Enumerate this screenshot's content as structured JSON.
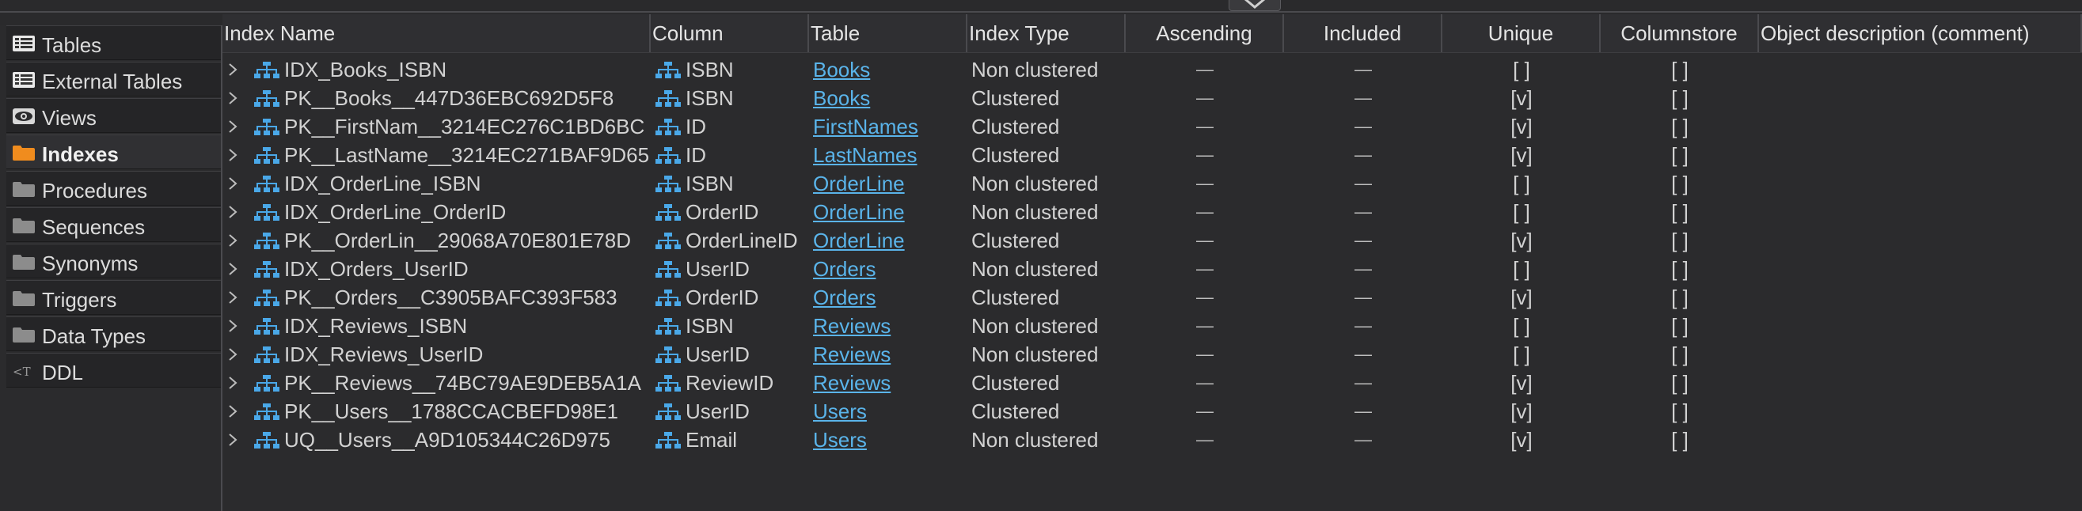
{
  "sidebar": {
    "items": [
      {
        "label": "Tables",
        "icon": "table-list-icon"
      },
      {
        "label": "External Tables",
        "icon": "table-list-icon"
      },
      {
        "label": "Views",
        "icon": "eye-icon"
      },
      {
        "label": "Indexes",
        "icon": "folder-icon",
        "active": true
      },
      {
        "label": "Procedures",
        "icon": "folder-icon"
      },
      {
        "label": "Sequences",
        "icon": "folder-icon"
      },
      {
        "label": "Synonyms",
        "icon": "folder-icon"
      },
      {
        "label": "Triggers",
        "icon": "folder-icon"
      },
      {
        "label": "Data Types",
        "icon": "folder-icon"
      },
      {
        "label": "DDL",
        "icon": "ddl-icon"
      }
    ]
  },
  "colors": {
    "background": "#2a2a2c",
    "link": "#5ab4ea",
    "active_folder": "#f08c1e",
    "folder": "#8c8c8c",
    "index_icon": "#4aa8e8"
  },
  "grid": {
    "columns": [
      "Index Name",
      "Column",
      "Table",
      "Index Type",
      "Ascending",
      "Included",
      "Unique",
      "Columnstore",
      "Object description (comment)"
    ],
    "rows": [
      {
        "name": "IDX_Books_ISBN",
        "column": "ISBN",
        "table": "Books",
        "type": "Non clustered",
        "ascending": "—",
        "included": "—",
        "unique": "[ ]",
        "columnstore": "[ ]"
      },
      {
        "name": "PK__Books__447D36EBC692D5F8",
        "column": "ISBN",
        "table": "Books",
        "type": "Clustered",
        "ascending": "—",
        "included": "—",
        "unique": "[v]",
        "columnstore": "[ ]"
      },
      {
        "name": "PK__FirstNam__3214EC276C1BD6BC",
        "column": "ID",
        "table": "FirstNames",
        "type": "Clustered",
        "ascending": "—",
        "included": "—",
        "unique": "[v]",
        "columnstore": "[ ]"
      },
      {
        "name": "PK__LastName__3214EC271BAF9D65",
        "column": "ID",
        "table": "LastNames",
        "type": "Clustered",
        "ascending": "—",
        "included": "—",
        "unique": "[v]",
        "columnstore": "[ ]"
      },
      {
        "name": "IDX_OrderLine_ISBN",
        "column": "ISBN",
        "table": "OrderLine",
        "type": "Non clustered",
        "ascending": "—",
        "included": "—",
        "unique": "[ ]",
        "columnstore": "[ ]"
      },
      {
        "name": "IDX_OrderLine_OrderID",
        "column": "OrderID",
        "table": "OrderLine",
        "type": "Non clustered",
        "ascending": "—",
        "included": "—",
        "unique": "[ ]",
        "columnstore": "[ ]"
      },
      {
        "name": "PK__OrderLin__29068A70E801E78D",
        "column": "OrderLineID",
        "table": "OrderLine",
        "type": "Clustered",
        "ascending": "—",
        "included": "—",
        "unique": "[v]",
        "columnstore": "[ ]"
      },
      {
        "name": "IDX_Orders_UserID",
        "column": "UserID",
        "table": "Orders",
        "type": "Non clustered",
        "ascending": "—",
        "included": "—",
        "unique": "[ ]",
        "columnstore": "[ ]"
      },
      {
        "name": "PK__Orders__C3905BAFC393F583",
        "column": "OrderID",
        "table": "Orders",
        "type": "Clustered",
        "ascending": "—",
        "included": "—",
        "unique": "[v]",
        "columnstore": "[ ]"
      },
      {
        "name": "IDX_Reviews_ISBN",
        "column": "ISBN",
        "table": "Reviews",
        "type": "Non clustered",
        "ascending": "—",
        "included": "—",
        "unique": "[ ]",
        "columnstore": "[ ]"
      },
      {
        "name": "IDX_Reviews_UserID",
        "column": "UserID",
        "table": "Reviews",
        "type": "Non clustered",
        "ascending": "—",
        "included": "—",
        "unique": "[ ]",
        "columnstore": "[ ]"
      },
      {
        "name": "PK__Reviews__74BC79AE9DEB5A1A",
        "column": "ReviewID",
        "table": "Reviews",
        "type": "Clustered",
        "ascending": "—",
        "included": "—",
        "unique": "[v]",
        "columnstore": "[ ]"
      },
      {
        "name": "PK__Users__1788CCACBEFD98E1",
        "column": "UserID",
        "table": "Users",
        "type": "Clustered",
        "ascending": "—",
        "included": "—",
        "unique": "[v]",
        "columnstore": "[ ]"
      },
      {
        "name": "UQ__Users__A9D105344C26D975",
        "column": "Email",
        "table": "Users",
        "type": "Non clustered",
        "ascending": "—",
        "included": "—",
        "unique": "[v]",
        "columnstore": "[ ]"
      }
    ]
  }
}
